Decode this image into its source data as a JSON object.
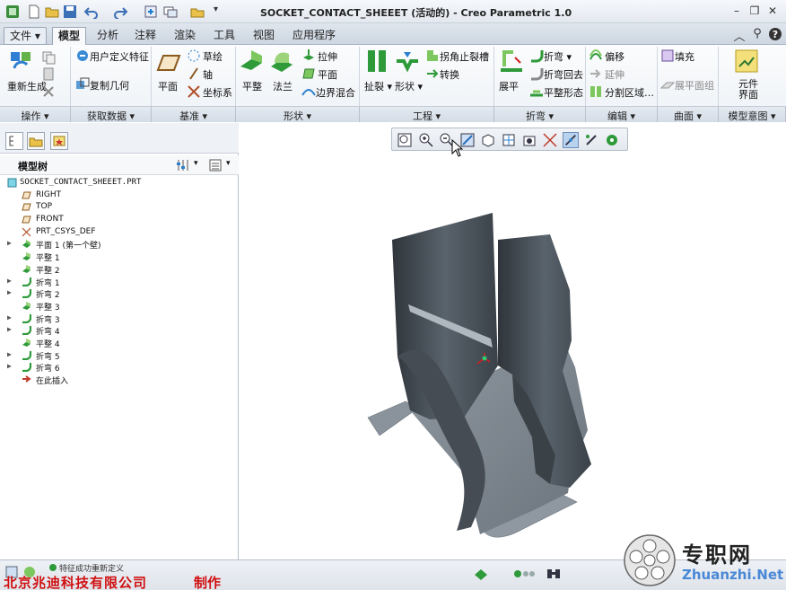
{
  "window": {
    "title": "SOCKET_CONTACT_SHEEET (活动的) - Creo Parametric 1.0",
    "controls": [
      "minimize",
      "restore",
      "close"
    ]
  },
  "menu": {
    "file": "文件",
    "tabs": [
      "模型",
      "分析",
      "注释",
      "渲染",
      "工具",
      "视图",
      "应用程序"
    ],
    "active_tab": "模型"
  },
  "ribbon": {
    "groups": {
      "operations": {
        "regenerate": "重新生成",
        "label": "操作"
      },
      "get_data": {
        "udf": "用户定义特征",
        "copy_geom": "复制几何",
        "label": "获取数据"
      },
      "datum": {
        "plane": "平面",
        "sketch": "草绘",
        "axis": "轴",
        "csys": "坐标系",
        "label": "基准"
      },
      "shapes": {
        "flat": "平整",
        "flange": "法兰",
        "extrude": "拉伸",
        "plane": "平面",
        "boundary_blend": "边界混合",
        "label": "形状"
      },
      "engineering": {
        "rip": "扯裂",
        "form": "形状",
        "corner_relief": "拐角止裂槽",
        "convert": "转换",
        "label": "工程"
      },
      "bends": {
        "unbend": "展平",
        "bend": "折弯",
        "bend_back": "折弯回去",
        "flat_pattern": "平整形态",
        "label": "折弯"
      },
      "editing": {
        "offset": "偏移",
        "extend": "延伸",
        "split_area": "分割区域…",
        "label": "编辑"
      },
      "surfaces": {
        "fill": "填充",
        "flat_quilt": "展平面组",
        "label": "曲面"
      },
      "model_intent": {
        "component_interface": "元件界面",
        "label": "模型意图"
      }
    }
  },
  "model_tree": {
    "title": "模型树",
    "items": [
      {
        "label": "SOCKET_CONTACT_SHEEET.PRT",
        "icon": "part-icon",
        "expandable": false,
        "root": true
      },
      {
        "label": "RIGHT",
        "icon": "datum-plane-icon",
        "expandable": false
      },
      {
        "label": "TOP",
        "icon": "datum-plane-icon",
        "expandable": false
      },
      {
        "label": "FRONT",
        "icon": "datum-plane-icon",
        "expandable": false
      },
      {
        "label": "PRT_CSYS_DEF",
        "icon": "csys-icon",
        "expandable": false
      },
      {
        "label": "平面 1 (第一个壁)",
        "icon": "wall-icon",
        "expandable": true
      },
      {
        "label": "平整 1",
        "icon": "flat-wall-icon",
        "expandable": false
      },
      {
        "label": "平整 2",
        "icon": "flat-wall-icon",
        "expandable": false
      },
      {
        "label": "折弯 1",
        "icon": "bend-icon",
        "expandable": true
      },
      {
        "label": "折弯 2",
        "icon": "bend-icon",
        "expandable": true
      },
      {
        "label": "平整 3",
        "icon": "flat-wall-icon",
        "expandable": false
      },
      {
        "label": "折弯 3",
        "icon": "bend-icon",
        "expandable": true
      },
      {
        "label": "折弯 4",
        "icon": "bend-icon",
        "expandable": true
      },
      {
        "label": "平整 4",
        "icon": "flat-wall-icon",
        "expandable": false
      },
      {
        "label": "折弯 5",
        "icon": "bend-icon",
        "expandable": true
      },
      {
        "label": "折弯 6",
        "icon": "bend-icon",
        "expandable": true
      },
      {
        "label": "在此插入",
        "icon": "insert-here-icon",
        "expandable": false
      }
    ]
  },
  "status": {
    "message": "特征成功重新定义",
    "company": "北京兆迪科技有限公司",
    "made": "制作"
  },
  "watermark": {
    "cn": "专职网",
    "url": "Zhuanzhi.Net"
  },
  "colors": {
    "accent_red": "#d01010",
    "model_dark": "#3d4349",
    "model_light": "#8c959d"
  }
}
